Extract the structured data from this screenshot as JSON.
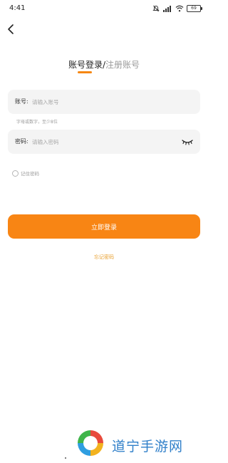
{
  "status_bar": {
    "time": "4:41",
    "battery": "69"
  },
  "header": {
    "tab_login": "账号登录",
    "separator": "/",
    "tab_register": "注册账号"
  },
  "form": {
    "account_label": "账号:",
    "account_placeholder": "请输入账号",
    "account_value": "",
    "account_hint": "字母或数字，至少8位",
    "password_label": "密码:",
    "password_placeholder": "请输入密码",
    "password_value": "",
    "remember_label": "记住密码",
    "login_button": "立即登录",
    "forgot_link": "忘记密码"
  },
  "watermark": {
    "text": "道宁手游网"
  },
  "colors": {
    "accent": "#f88514",
    "forgot_link": "#e8a030",
    "watermark_text": "#2f7fc9"
  }
}
